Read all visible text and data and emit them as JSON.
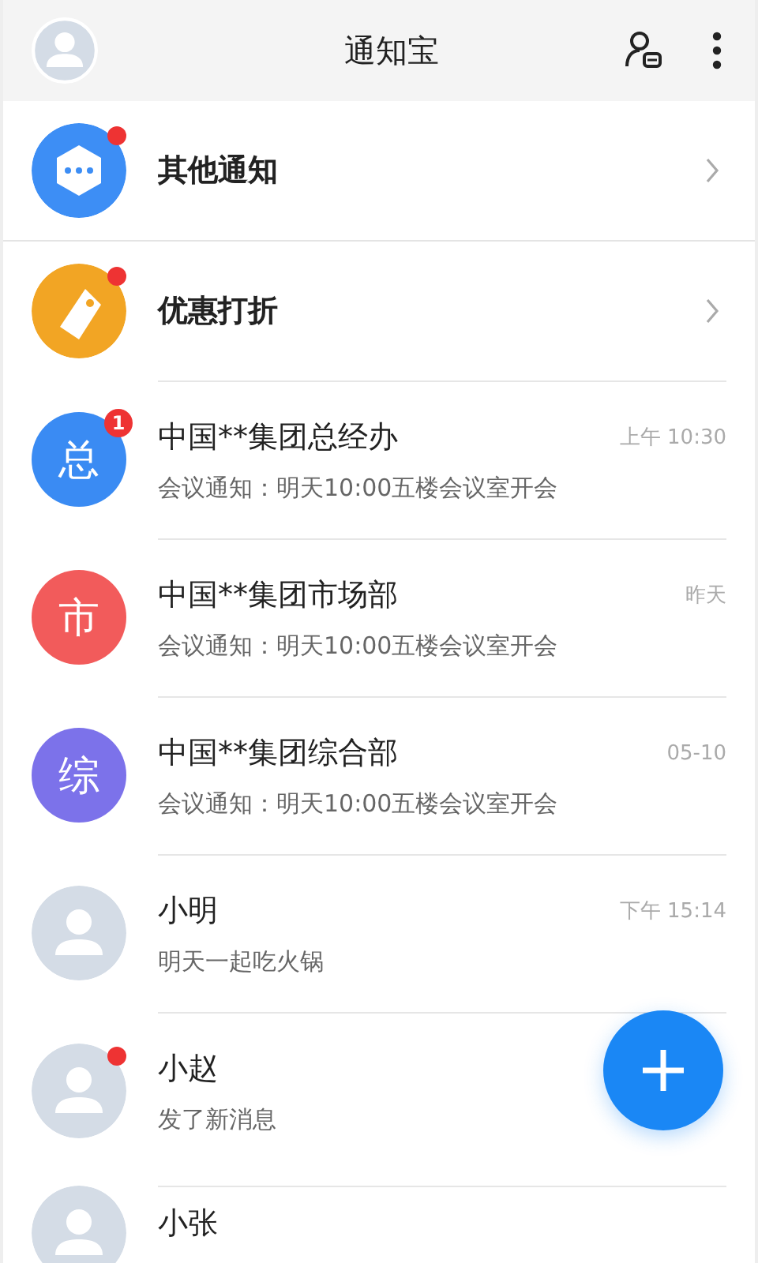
{
  "header": {
    "title": "通知宝"
  },
  "entries": [
    {
      "kind": "hexagon",
      "label": "其他通知",
      "color": "#3d8ef5",
      "unread_dot": true
    },
    {
      "kind": "tag",
      "label": "优惠打折",
      "color": "#f2a524",
      "unread_dot": true
    }
  ],
  "chats": [
    {
      "kind": "letter",
      "avatar_text": "总",
      "color": "#3a8bf3",
      "name": "中国**集团总经办",
      "time": "上午 10:30",
      "preview": "会议通知：明天10:00五楼会议室开会",
      "badge": "1",
      "unread_dot": false
    },
    {
      "kind": "letter",
      "avatar_text": "市",
      "color": "#f25b5b",
      "name": "中国**集团市场部",
      "time": "昨天",
      "preview": "会议通知：明天10:00五楼会议室开会",
      "unread_dot": false
    },
    {
      "kind": "letter",
      "avatar_text": "综",
      "color": "#7c72ea",
      "name": "中国**集团综合部",
      "time": "05-10",
      "preview": "会议通知：明天10:00五楼会议室开会",
      "unread_dot": false
    },
    {
      "kind": "person",
      "name": "小明",
      "time": "下午 15:14",
      "preview": "明天一起吃火锅",
      "unread_dot": false
    },
    {
      "kind": "person",
      "name": "小赵",
      "preview": "发了新消息",
      "unread_dot": true
    },
    {
      "kind": "person",
      "name": "小张",
      "unread_dot": false
    }
  ]
}
